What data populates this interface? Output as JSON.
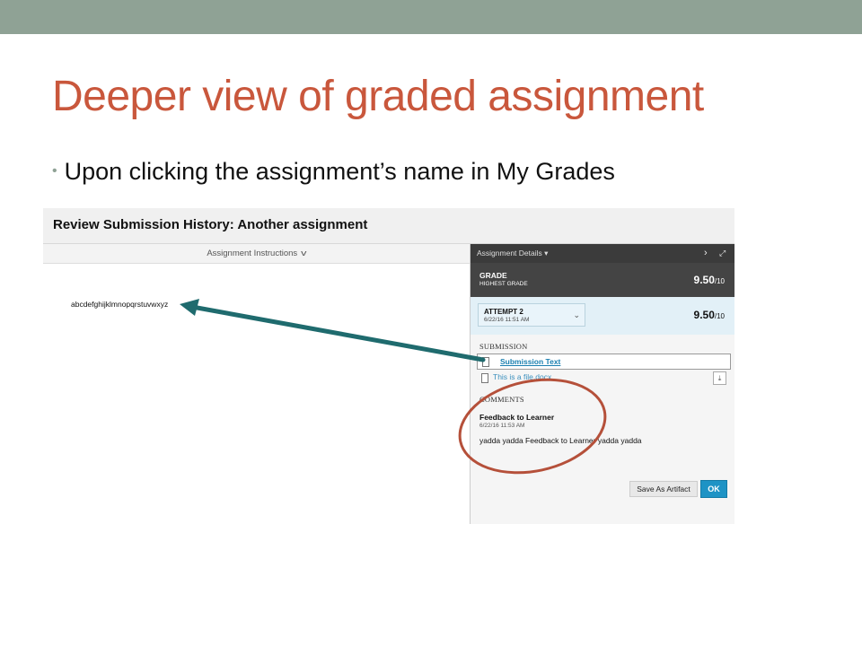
{
  "slide": {
    "title": "Deeper view of graded assignment",
    "bullet": "Upon clicking the assignment’s name in My Grades"
  },
  "screenshot": {
    "title": "Review Submission History: Another assignment",
    "instructions_label": "Assignment Instructions",
    "body_text": "abcdefghijklmnopqrstuvwxyz",
    "panel": {
      "header_label": "Assignment Details",
      "grade_label": "GRADE",
      "grade_sub": "HIGHEST GRADE",
      "grade_value": "9.50",
      "grade_denominator": "/10",
      "attempt_label": "ATTEMPT 2",
      "attempt_date": "6/22/16 11:51 AM",
      "attempt_value": "9.50",
      "attempt_denominator": "/10",
      "submission_heading": "SUBMISSION",
      "submission_link": "Submission Text",
      "file_link": "This is a file.docx",
      "comments_heading": "COMMENTS",
      "feedback_title": "Feedback to Learner",
      "feedback_date": "6/22/16 11:53 AM",
      "feedback_text": "yadda yadda Feedback to Learner yadda yadda",
      "save_artifact_label": "Save As Artifact",
      "ok_label": "OK"
    }
  },
  "colors": {
    "top_band": "#8fa295",
    "title": "#c9573c",
    "arrow": "#1f6b6e",
    "circle": "#b5503a"
  }
}
